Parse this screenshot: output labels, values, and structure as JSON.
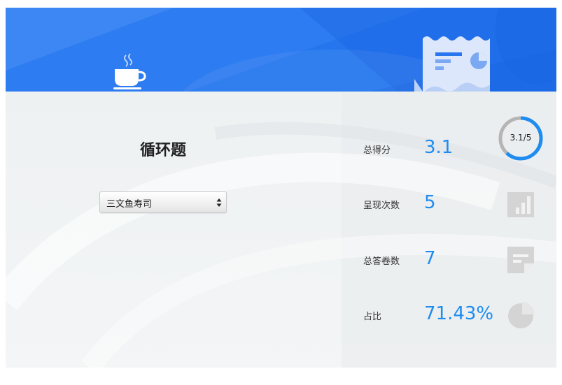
{
  "header": {
    "left_icon": "coffee-cup-icon",
    "right_icon": "report-chart-icon",
    "accent_color": "#1f6fe8"
  },
  "main": {
    "title": "循环题",
    "select": {
      "value": "三文鱼寿司"
    }
  },
  "stats": [
    {
      "label": "总得分",
      "value": "3.1",
      "icon": "score-ring",
      "ring_text": "3.1/5",
      "ring_fraction": 0.62
    },
    {
      "label": "呈现次数",
      "value": "5",
      "icon": "bar-chart-icon"
    },
    {
      "label": "总答卷数",
      "value": "7",
      "icon": "note-icon"
    },
    {
      "label": "占比",
      "value": "71.43%",
      "icon": "pie-chart-icon"
    }
  ],
  "colors": {
    "value_blue": "#1e8cf0",
    "ring_gray": "#b5b5b5",
    "icon_gray": "#cfcfcf"
  }
}
